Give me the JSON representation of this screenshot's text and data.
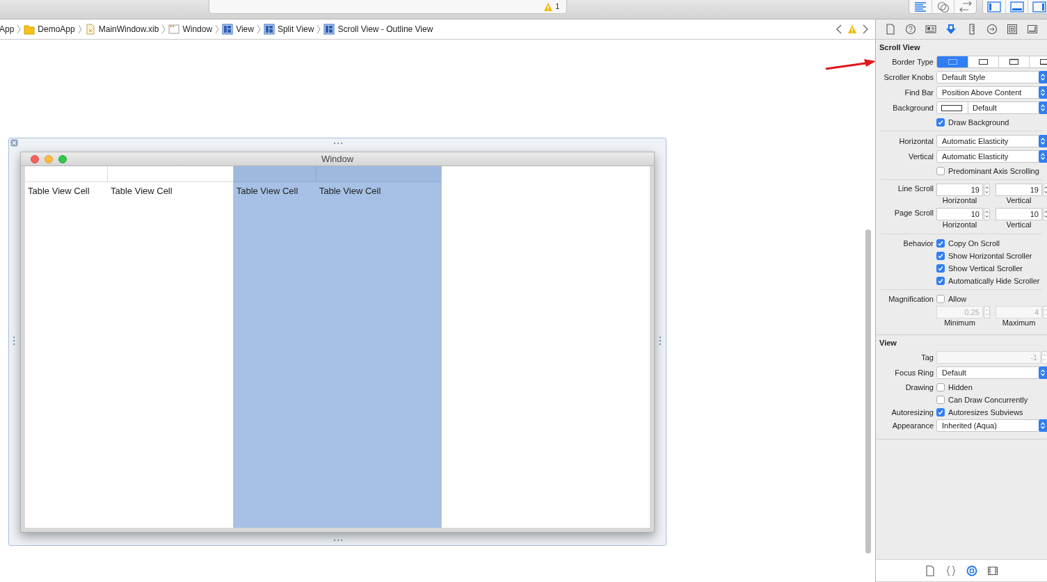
{
  "toolbar": {
    "warning_count": "1",
    "editor_modes": [
      {
        "selected": true
      },
      {
        "selected": false
      },
      {
        "selected": false
      }
    ],
    "panels": [
      {
        "on": true
      },
      {
        "on": true
      },
      {
        "on": true
      }
    ]
  },
  "breadcrumbs": [
    {
      "kind": "none",
      "label": "App"
    },
    {
      "kind": "folder",
      "label": "DemoApp"
    },
    {
      "kind": "xib",
      "label": "MainWindow.xib"
    },
    {
      "kind": "window",
      "label": "Window"
    },
    {
      "kind": "view",
      "label": "View"
    },
    {
      "kind": "view",
      "label": "Split View"
    },
    {
      "kind": "view",
      "label": "Scroll View - Outline View"
    }
  ],
  "canvas": {
    "window_title": "Window",
    "panes": [
      {
        "selected": false,
        "cells": [
          "Table View Cell",
          "Table View Cell"
        ]
      },
      {
        "selected": true,
        "cells": [
          "Table View Cell",
          "Table View Cell"
        ]
      },
      {
        "selected": false
      }
    ]
  },
  "inspector": {
    "tabs": [
      {
        "selected": false
      },
      {
        "selected": false
      },
      {
        "selected": false
      },
      {
        "selected": true
      },
      {
        "selected": false
      },
      {
        "selected": false
      },
      {
        "selected": false
      },
      {
        "selected": false
      }
    ],
    "sections": [
      {
        "title": "Scroll View",
        "groups": [
          [
            {
              "kind": "segmented",
              "label": "Border Type",
              "segments": [
                {
                  "selected": true
                },
                {
                  "selected": false
                },
                {
                  "selected": false
                },
                {
                  "selected": false
                }
              ]
            },
            {
              "kind": "popup",
              "label": "Scroller Knobs",
              "value": "Default Style"
            },
            {
              "kind": "popup",
              "label": "Find Bar",
              "value": "Position Above Content"
            },
            {
              "kind": "color_popup",
              "label": "Background",
              "value": "Default"
            },
            {
              "kind": "checkbox",
              "text": "Draw Background",
              "checked": true
            }
          ],
          [
            {
              "kind": "popup",
              "label": "Horizontal",
              "value": "Automatic Elasticity"
            },
            {
              "kind": "popup",
              "label": "Vertical",
              "value": "Automatic Elasticity"
            },
            {
              "kind": "checkbox",
              "text": "Predominant Axis Scrolling",
              "checked": false
            }
          ],
          [
            {
              "kind": "steppers",
              "label": "Line Scroll",
              "fields": [
                {
                  "value": "19",
                  "caption": "Horizontal",
                  "disabled": false
                },
                {
                  "value": "19",
                  "caption": "Vertical",
                  "disabled": false
                }
              ]
            },
            {
              "kind": "steppers",
              "label": "Page Scroll",
              "fields": [
                {
                  "value": "10",
                  "caption": "Horizontal",
                  "disabled": false
                },
                {
                  "value": "10",
                  "caption": "Vertical",
                  "disabled": false
                }
              ]
            }
          ],
          [
            {
              "kind": "checkbox",
              "label": "Behavior",
              "text": "Copy On Scroll",
              "checked": true
            },
            {
              "kind": "checkbox",
              "text": "Show Horizontal Scroller",
              "checked": true
            },
            {
              "kind": "checkbox",
              "text": "Show Vertical Scroller",
              "checked": true
            },
            {
              "kind": "checkbox",
              "text": "Automatically Hide Scroller",
              "checked": true
            }
          ],
          [
            {
              "kind": "checkbox",
              "label": "Magnification",
              "text": "Allow",
              "checked": false
            },
            {
              "kind": "steppers",
              "fields": [
                {
                  "placeholder": "0.25",
                  "caption": "Minimum",
                  "disabled": true
                },
                {
                  "placeholder": "4",
                  "caption": "Maximum",
                  "disabled": true
                }
              ]
            }
          ]
        ]
      },
      {
        "title": "View",
        "groups": [
          [
            {
              "kind": "stepper",
              "label": "Tag",
              "placeholder": "-1",
              "disabled": true
            },
            {
              "kind": "popup",
              "label": "Focus Ring",
              "value": "Default"
            },
            {
              "kind": "checkbox",
              "label": "Drawing",
              "text": "Hidden",
              "checked": false
            },
            {
              "kind": "checkbox",
              "text": "Can Draw Concurrently",
              "checked": false
            },
            {
              "kind": "checkbox",
              "label": "Autoresizing",
              "text": "Autoresizes Subviews",
              "checked": true
            },
            {
              "kind": "popup",
              "label": "Appearance",
              "value": "Inherited (Aqua)"
            }
          ]
        ]
      }
    ],
    "library_tabs": [
      {
        "selected": false
      },
      {
        "selected": false
      },
      {
        "selected": true
      },
      {
        "selected": false
      }
    ]
  }
}
